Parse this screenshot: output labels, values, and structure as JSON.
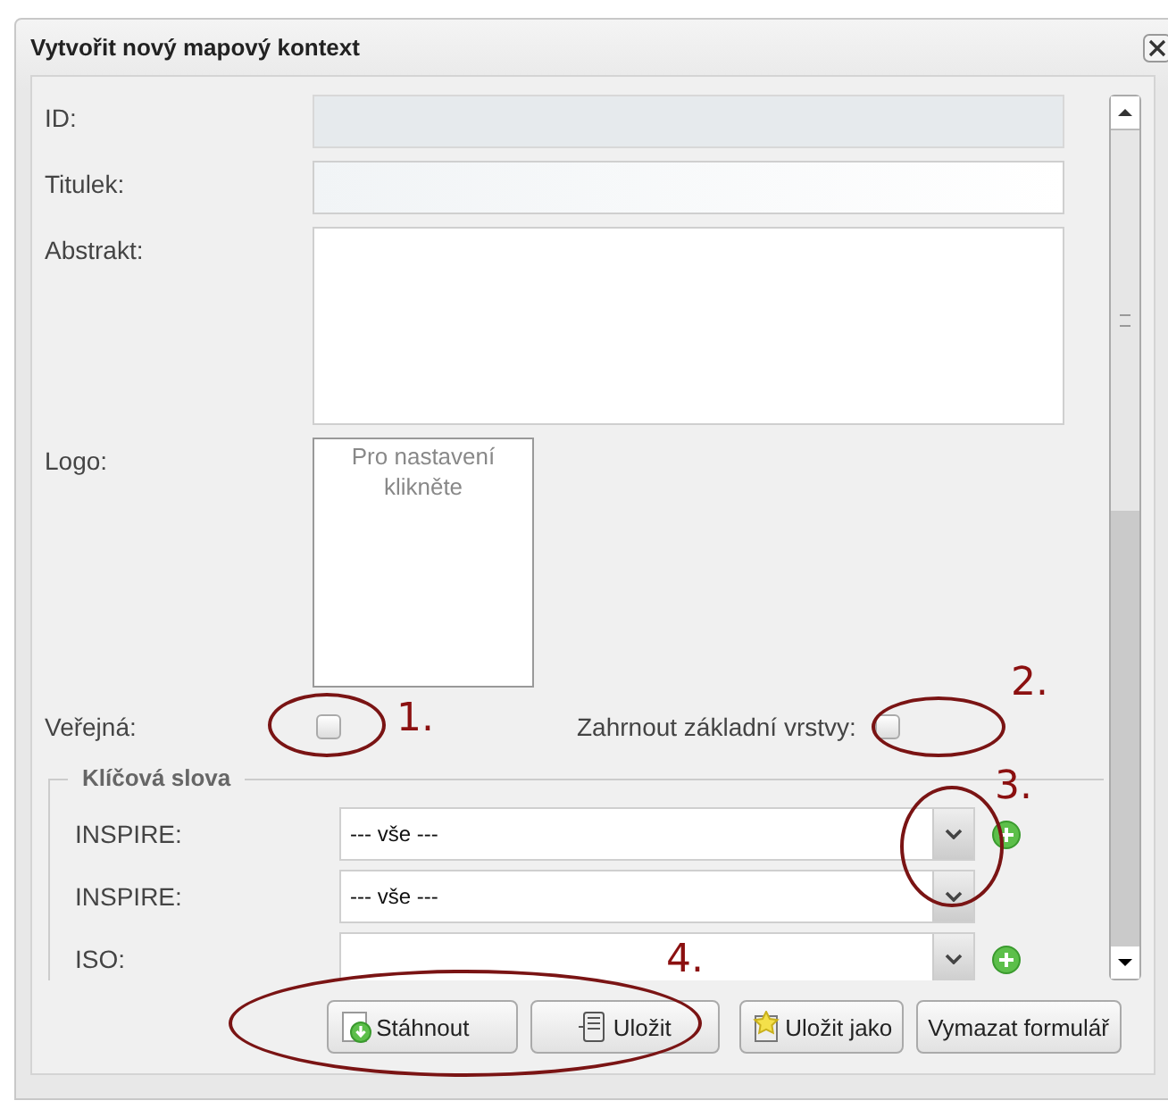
{
  "dialog": {
    "title": "Vytvořit nový mapový kontext"
  },
  "fields": [
    {
      "kind": "text",
      "label": "ID:",
      "disabled": true
    },
    {
      "kind": "text",
      "label": "Titulek:",
      "disabled": false
    },
    {
      "kind": "textarea",
      "label": "Abstrakt:"
    },
    {
      "kind": "logo",
      "label": "Logo:",
      "hint": "Pro nastavení klikněte"
    }
  ],
  "flags": [
    {
      "label": "Veřejná:",
      "checked": false
    },
    {
      "label": "Zahrnout základní vrstvy:",
      "checked": false
    }
  ],
  "keywords": {
    "legend": "Klíčová slova",
    "rows": [
      {
        "label": "INSPIRE:",
        "value": "--- vše ---",
        "addable": true
      },
      {
        "label": "INSPIRE:",
        "value": "--- vše ---",
        "addable": false
      },
      {
        "label": "ISO:",
        "addable": true
      }
    ]
  },
  "buttons": [
    {
      "kind": "download",
      "label": "Stáhnout"
    },
    {
      "kind": "save",
      "label": "Uložit"
    },
    {
      "kind": "saveas",
      "label": "Uložit jako"
    },
    {
      "kind": "plain",
      "label": "Vymazat formulář"
    }
  ],
  "annotations": [
    "1.",
    "2.",
    "3.",
    "4."
  ]
}
